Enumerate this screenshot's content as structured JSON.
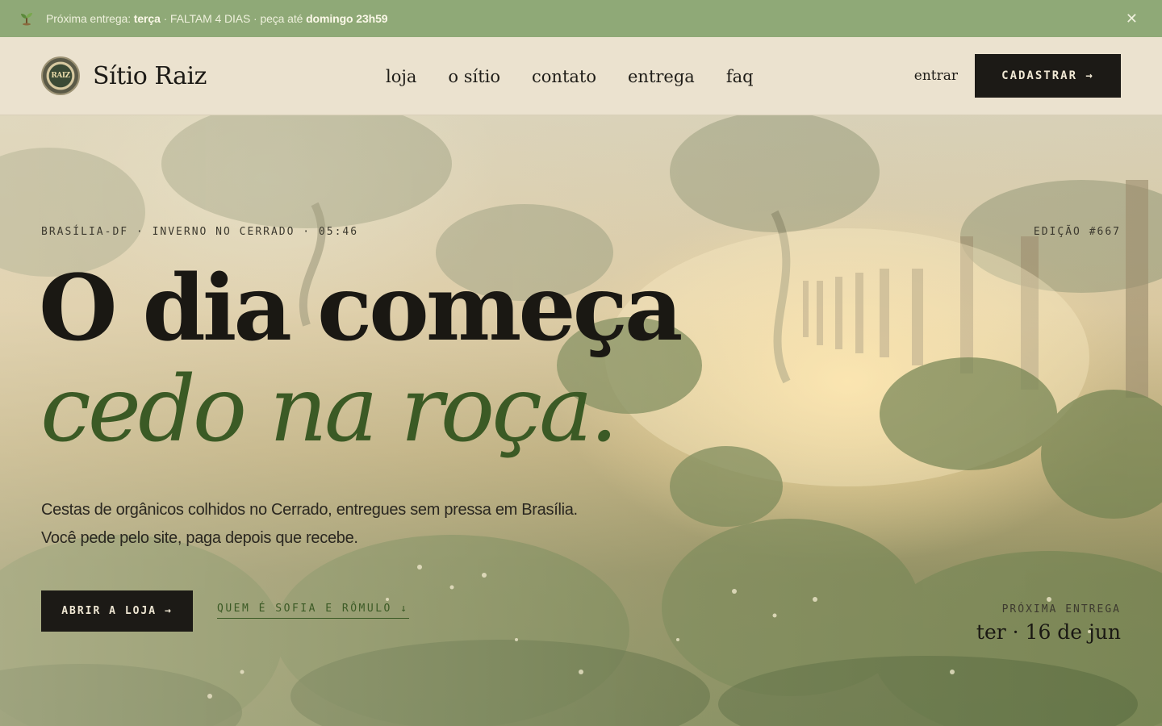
{
  "topbar": {
    "prefix": "Próxima entrega: ",
    "day": "terça",
    "countdown": " · FALTAM 4 DIAS · peça até ",
    "deadline": "domingo 23h59",
    "close_label": "✕"
  },
  "header": {
    "badge_text": "RAIZ",
    "brand": "Sítio Raiz",
    "nav": [
      "loja",
      "o sítio",
      "contato",
      "entrega",
      "faq"
    ],
    "login": "entrar",
    "signup": "CADASTRAR →"
  },
  "hero": {
    "kicker": "BRASÍLIA-DF · INVERNO NO CERRADO · 05:46",
    "edition": "EDIÇÃO #667",
    "headline_line1": "O dia começa",
    "headline_line2": "cedo na roça.",
    "lead_line1": "Cestas de orgânicos colhidos no Cerrado, entregues sem pressa em Brasília.",
    "lead_line2": "Você pede pelo site, paga depois que recebe.",
    "cta_shop": "ABRIR A LOJA →",
    "cta_about": "QUEM É SOFIA E RÔMULO ↓",
    "next_delivery_label": "PRÓXIMA ENTREGA",
    "next_delivery_date": "ter · 16 de jun"
  },
  "colors": {
    "topbar_bg": "#8fa977",
    "header_bg": "#ebe2cf",
    "ink": "#1c1a16",
    "accent_green": "#3b5a25"
  }
}
